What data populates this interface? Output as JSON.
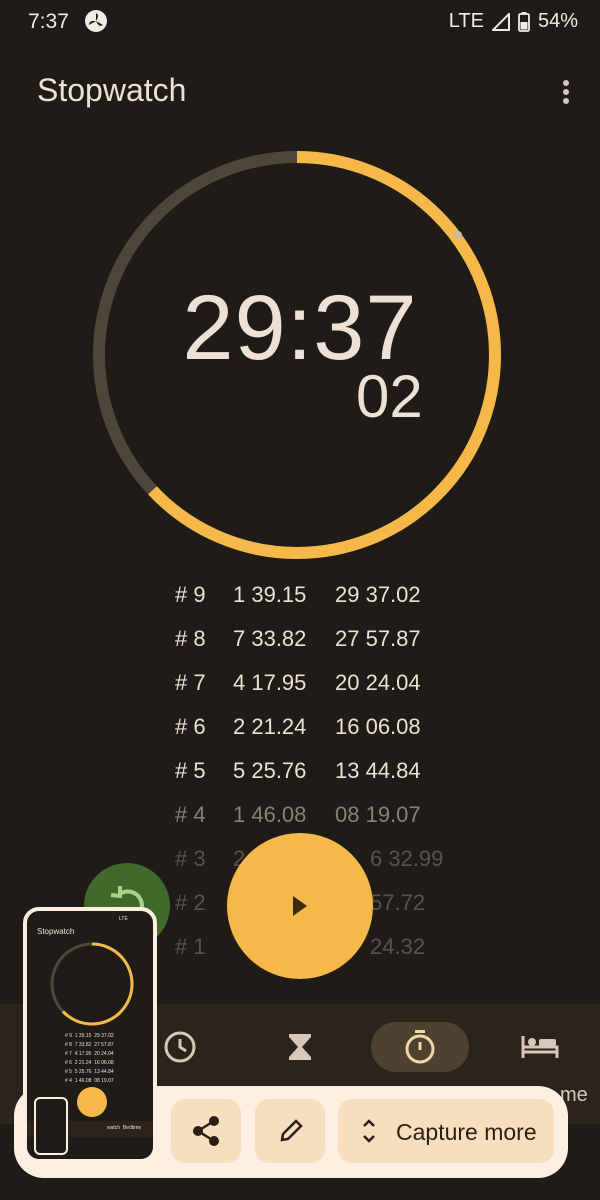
{
  "status": {
    "time": "7:37",
    "network": "LTE",
    "battery": "54%",
    "fan_icon": "fan-icon",
    "signal_icon": "signal-icon",
    "battery_icon": "battery-icon"
  },
  "app": {
    "title": "Stopwatch",
    "menu_icon": "more-vert-icon"
  },
  "stopwatch": {
    "main": "29:37",
    "centiseconds": "02",
    "progress_fraction": 0.63,
    "accent_color": "#f7b84a",
    "track_color": "#4f463b"
  },
  "laps": [
    {
      "no": "# 9",
      "split": "1 39.15",
      "total": "29 37.02"
    },
    {
      "no": "# 8",
      "split": "7 33.82",
      "total": "27 57.87"
    },
    {
      "no": "# 7",
      "split": "4 17.95",
      "total": "20 24.04"
    },
    {
      "no": "# 6",
      "split": "2 21.24",
      "total": "16 06.08"
    },
    {
      "no": "# 5",
      "split": "5 25.76",
      "total": "13 44.84"
    },
    {
      "no": "# 4",
      "split": "1 46.08",
      "total": "08 19.07"
    },
    {
      "no": "# 3",
      "split": "2",
      "total": "6 32.99"
    },
    {
      "no": "# 2",
      "split": "",
      "total": "57.72"
    },
    {
      "no": "# 1",
      "split": "",
      "total": "24.32"
    }
  ],
  "controls": {
    "reset_icon": "reset-icon",
    "play_icon": "play-icon"
  },
  "nav": {
    "items": [
      {
        "icon": "clock-icon",
        "label": ""
      },
      {
        "icon": "hourglass-icon",
        "label": ""
      },
      {
        "icon": "stopwatch-icon",
        "label": ""
      },
      {
        "icon": "bed-icon",
        "label": "me"
      }
    ]
  },
  "capture": {
    "share_icon": "share-icon",
    "edit_icon": "edit-icon",
    "capture_icon": "unfold-icon",
    "capture_label": "Capture more"
  },
  "thumbnail": {
    "title": "Stopwatch",
    "status": "LTE",
    "rows": [
      "# 9  1 39.15  29 37.02",
      "# 8  7 33.82  27 57.87",
      "# 7  4 17.95  20 24.04",
      "# 6  2 21.24  16 06.08",
      "# 5  5 25.76  13 44.84",
      "# 4  1 46.08  08 19.07"
    ],
    "nav_labels": "watch  Bedtime"
  }
}
